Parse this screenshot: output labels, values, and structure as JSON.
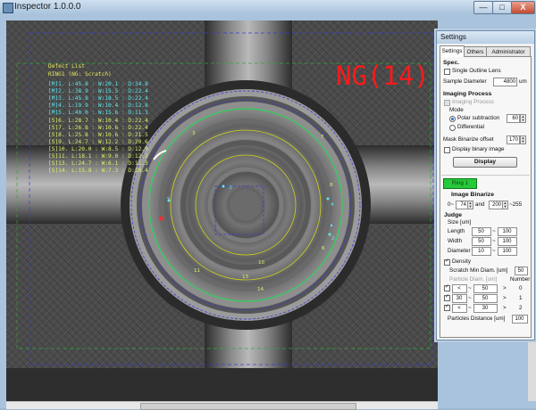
{
  "window": {
    "title": "Inspector 1.0.0.0",
    "min_label": "—",
    "max_label": "□",
    "close_label": "X"
  },
  "overlay": {
    "defect_list_title": "Defect List",
    "defect_list_subtitle": "RING1 (NG: Scratch)",
    "defect_lines": [
      {
        "text": "[M]1. L:45.8 : W:20.1 : D:34.8",
        "color": "cyan"
      },
      {
        "text": "[M]2. L:38.9 : W:15.5 : D:22.4",
        "color": "cyan"
      },
      {
        "text": "[M]3. L:45.8 : W:18.5 : D:22.4",
        "color": "cyan"
      },
      {
        "text": "[M]4. L:19.9 : W:10.4 : D:12.8",
        "color": "cyan"
      },
      {
        "text": "[M]5. L:40.0 : W:15.6 : D:11.3",
        "color": "cyan"
      },
      {
        "text": "[S]6. L:28.7 : W:10.4 : D:22.4",
        "color": "green"
      },
      {
        "text": "[S]7. L:26.8 : W:10.6 : D:22.4",
        "color": "green"
      },
      {
        "text": "[S]8. L:25.8 : W:10.6 : D:21.5",
        "color": "green"
      },
      {
        "text": "[S]9. L:24.7 : W:12.2 : D:20.6",
        "color": "green"
      },
      {
        "text": "[S]10. L:20.0 : W:8.5 : D:12.9",
        "color": "green"
      },
      {
        "text": "[S]11. L:18.1 : W:9.0 : D:12.2",
        "color": "green"
      },
      {
        "text": "[S]13. L:24.7 : W:6.1 : D:11.3",
        "color": "green"
      },
      {
        "text": "[S]14. L:15.8 : W:7.3 : D:10.4",
        "color": "green"
      }
    ],
    "ng_text": "NG(14)",
    "defect_labels": [
      {
        "text": "3",
        "color": "green"
      },
      {
        "text": "7",
        "color": "green"
      },
      {
        "text": "8",
        "color": "green"
      },
      {
        "text": "5",
        "color": "cyan"
      },
      {
        "text": "3",
        "color": "cyan"
      },
      {
        "text": "4",
        "color": "cyan"
      },
      {
        "text": "2",
        "color": "cyan"
      },
      {
        "text": "6",
        "color": "green"
      },
      {
        "text": "10",
        "color": "green"
      },
      {
        "text": "11",
        "color": "green"
      },
      {
        "text": "13",
        "color": "green"
      },
      {
        "text": "14",
        "color": "green"
      }
    ]
  },
  "settings": {
    "title": "Settings",
    "tabs": [
      "Settings",
      "Others",
      "Administrator"
    ],
    "spec_heading": "Spec.",
    "single_outline_lens_label": "Single Outline Lens",
    "sample_diameter_label": "Sample Diameter",
    "sample_diameter_value": "4800",
    "sample_diameter_unit": "um",
    "imaging_process_heading": "Imaging Process",
    "imaging_process_checkbox_label": "Imaging Process",
    "mode_label": "Mode",
    "polar_subtraction_label": "Polar subtraction",
    "polar_subtraction_value": "60",
    "differential_label": "Differential",
    "mask_binarize_label": "Mask Binarize offset",
    "mask_binarize_value": "170",
    "display_binary_label": "Display binary image",
    "display_button_label": "Display",
    "ring_button_label": "Ring 1",
    "image_binarize_heading": "Image Binarize",
    "binarize_prefix": "0~",
    "binarize_low": "74",
    "binarize_and": "and",
    "binarize_high": "200",
    "binarize_suffix": "~255",
    "judge_heading": "Judge",
    "size_label": "Size [um]",
    "length_label": "Length",
    "length_min": "50",
    "length_max": "100",
    "width_label": "Width",
    "width_min": "50",
    "width_max": "100",
    "diameter_label": "Diameter",
    "diameter_min": "10",
    "diameter_max": "100",
    "density_label": "Density",
    "scratch_min_label": "Scratch Min Diam. [um]",
    "scratch_min_value": "50",
    "particle_diam_label": "Particle Diam. [um]",
    "number_label": "Number",
    "particle_rows": [
      {
        "op1": "<",
        "v1": "50",
        "op2": ">",
        "num": "0"
      },
      {
        "op1": "30",
        "v1": "50",
        "op2": ">",
        "num": "1"
      },
      {
        "op1": "<",
        "v1": "30",
        "op2": ">",
        "num": "2"
      }
    ],
    "particles_distance_label": "Particles Distance [um]",
    "particles_distance_value": "100"
  },
  "colors": {
    "ng_red": "#ff1a1a",
    "defect_cyan": "#5ee8f0",
    "defect_green": "#d8f26a",
    "ring_button_green": "#27c83a"
  }
}
